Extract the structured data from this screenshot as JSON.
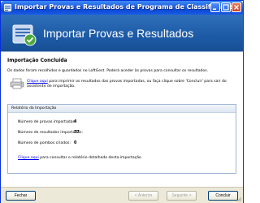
{
  "window": {
    "title": "Importar Provas e Resultados de Programa de Classificações"
  },
  "banner": {
    "title": "Importar Provas e Resultados"
  },
  "content": {
    "section_title": "Importação Concluída",
    "description": "Os dados foram recolhidos e guardados no LoftGest.  Poderá aceder às provas para consultar os resultados.",
    "print_link": "Clique aqui",
    "print_text": " para imprimir os resultados das provas importadas, ou faça clique sobre 'Concluir' para sair do assistente de importação."
  },
  "report": {
    "header": "Relatório da Importação",
    "stats": [
      {
        "label": "Número de provas importadas:",
        "value": "4"
      },
      {
        "label": "Número de resultados importados:",
        "value": "77"
      },
      {
        "label": "Número de pombos criados:",
        "value": "0"
      }
    ],
    "footer_link": "Clique aqui",
    "footer_text": " para consultar o relatório detalhado desta importação"
  },
  "buttons": {
    "close": "Fechar",
    "previous": "< Anterior",
    "next": "Seguinte >",
    "finish": "Concluir"
  },
  "icons": {
    "title": "app-icon",
    "banner": "import-wizard-icon",
    "print": "printer-icon"
  },
  "colors": {
    "titlebar": "#0d4ad4",
    "banner": "#1d5aa6",
    "link": "#0000ee"
  }
}
